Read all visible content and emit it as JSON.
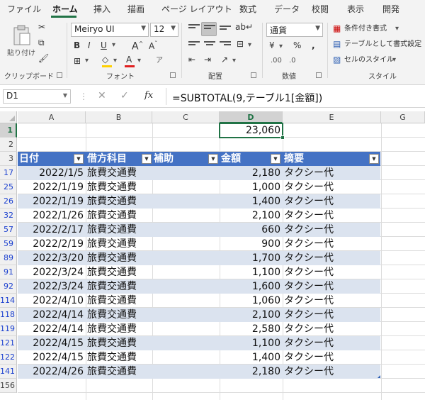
{
  "menu": [
    "ファイル",
    "ホーム",
    "挿入",
    "描画",
    "ページ レイアウト",
    "数式",
    "データ",
    "校閲",
    "表示",
    "開発"
  ],
  "ribbon": {
    "clipboard": {
      "paste": "貼り付け",
      "label": "クリップボード"
    },
    "font": {
      "name": "Meiryo UI",
      "size": "12",
      "label": "フォント"
    },
    "alignment": {
      "label": "配置"
    },
    "number": {
      "format": "通貨",
      "label": "数値"
    },
    "styles": {
      "conditional": "条件付き書式",
      "table": "テーブルとして書式設定",
      "cell": "セルのスタイル",
      "label": "スタイル"
    }
  },
  "formula_bar": {
    "name_box": "D1",
    "fx": "fx",
    "formula": "=SUBTOTAL(9,テーブル1[金額])"
  },
  "columns": [
    "A",
    "B",
    "C",
    "D",
    "E",
    "G"
  ],
  "row_numbers": [
    "1",
    "2",
    "3",
    "17",
    "25",
    "26",
    "32",
    "57",
    "59",
    "89",
    "91",
    "92",
    "114",
    "118",
    "119",
    "121",
    "122",
    "141",
    "156"
  ],
  "d1_value": "23,060",
  "table": {
    "headers": [
      "日付",
      "借方科目",
      "補助",
      "金額",
      "摘要"
    ],
    "rows": [
      [
        "2022/1/5",
        "旅費交通費",
        "",
        "2,180",
        "タクシー代"
      ],
      [
        "2022/1/19",
        "旅費交通費",
        "",
        "1,000",
        "タクシー代"
      ],
      [
        "2022/1/19",
        "旅費交通費",
        "",
        "1,400",
        "タクシー代"
      ],
      [
        "2022/1/26",
        "旅費交通費",
        "",
        "2,100",
        "タクシー代"
      ],
      [
        "2022/2/17",
        "旅費交通費",
        "",
        "660",
        "タクシー代"
      ],
      [
        "2022/2/19",
        "旅費交通費",
        "",
        "900",
        "タクシー代"
      ],
      [
        "2022/3/20",
        "旅費交通費",
        "",
        "1,700",
        "タクシー代"
      ],
      [
        "2022/3/24",
        "旅費交通費",
        "",
        "1,100",
        "タクシー代"
      ],
      [
        "2022/3/24",
        "旅費交通費",
        "",
        "1,600",
        "タクシー代"
      ],
      [
        "2022/4/10",
        "旅費交通費",
        "",
        "1,060",
        "タクシー代"
      ],
      [
        "2022/4/14",
        "旅費交通費",
        "",
        "2,100",
        "タクシー代"
      ],
      [
        "2022/4/14",
        "旅費交通費",
        "",
        "2,580",
        "タクシー代"
      ],
      [
        "2022/4/15",
        "旅費交通費",
        "",
        "1,100",
        "タクシー代"
      ],
      [
        "2022/4/15",
        "旅費交通費",
        "",
        "1,400",
        "タクシー代"
      ],
      [
        "2022/4/26",
        "旅費交通費",
        "",
        "2,180",
        "タクシー代"
      ]
    ]
  },
  "colors": {
    "accent": "#217346",
    "table_header": "#4472c4",
    "table_band": "#dbe3ef",
    "row_number_filtered": "#1a3fcf"
  }
}
